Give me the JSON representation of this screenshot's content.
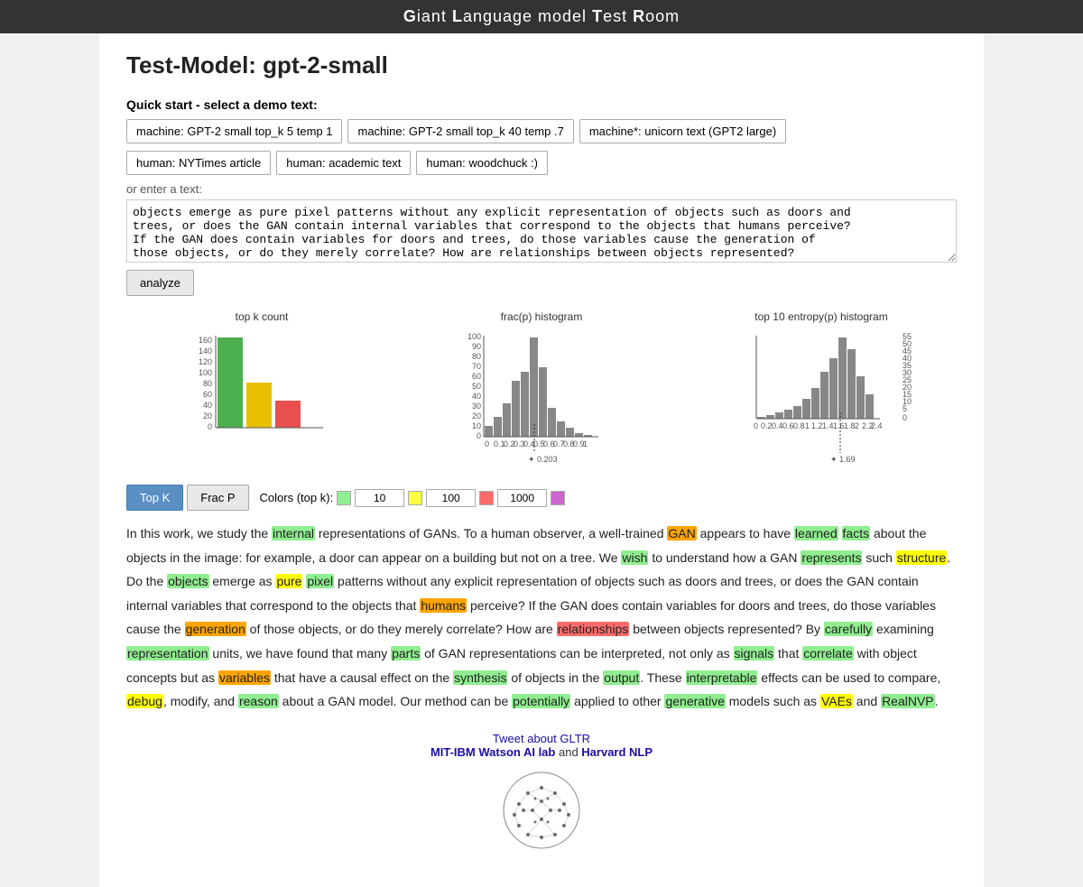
{
  "topbar": {
    "title": "Giant Language model Test Room",
    "title_parts": [
      "G",
      "iant ",
      "L",
      "anguage model ",
      "T",
      "est ",
      "R",
      "oom"
    ]
  },
  "page": {
    "title": "Test-Model: gpt-2-small"
  },
  "quick_start": {
    "label": "Quick start - select a demo text:",
    "buttons": [
      "machine: GPT-2 small top_k 5 temp 1",
      "machine: GPT-2 small top_k 40 temp .7",
      "machine*: unicorn text (GPT2 large)",
      "human: NYTimes article",
      "human: academic text",
      "human: woodchuck :)"
    ]
  },
  "enter_text": {
    "label": "or enter a text:",
    "placeholder": "objects emerge as pure pixel patterns without any explicit representation of objects such as doors and trees, or does the GAN contain internal variables that correspond to the objects that humans perceive?\nIf the GAN does contain variables for doors and trees, do those variables cause the generation of\nthose objects, or do they merely correlate? How are relationships between objects represented?",
    "value": "objects emerge as pure pixel patterns without any explicit representation of objects such as doors and\ntrees, or does the GAN contain internal variables that correspond to the objects that humans perceive?\nIf the GAN does contain variables for doors and trees, do those variables cause the generation of\nthose objects, or do they merely correlate? How are relationships between objects represented?"
  },
  "analyze_btn": "analyze",
  "charts": {
    "topk": {
      "title": "top k count"
    },
    "fracp": {
      "title": "frac(p) histogram",
      "marker": "0.203"
    },
    "entropy": {
      "title": "top 10 entropy(p) histogram",
      "marker": "1.69"
    }
  },
  "tabs": {
    "top_k": "Top K",
    "frac_p": "Frac P",
    "colors_label": "Colors (top k):",
    "inputs": [
      "10",
      "100",
      "1000"
    ],
    "swatches": [
      "#90ee90",
      "#ffff44",
      "#ff6b6b",
      "#cc66cc"
    ]
  },
  "result_paragraph": "In this work, we study the internal representations of GANs. To a human observer, a well-trained GAN appears to have learned facts about the objects in the image: for example, a door can appear on a building but not on a tree. We wish to understand how a GAN represents such structure. Do the objects emerge as pure pixel patterns without any explicit representation of objects such as doors and trees, or does the GAN contain internal variables that correspond to the objects that humans perceive? If the GAN does contain variables for doors and trees, do those variables cause the generation of those objects, or do they merely correlate? How are relationships between objects represented? By carefully examining representation units, we have found that many parts of GAN representations can be interpreted, not only as signals that correlate with object concepts but as variables that have a causal effect on the synthesis of objects in the output. These interpretable effects can be used to compare, debug, modify, and reason about a GAN model. Our method can be potentially applied to other generative models such as VAEs and RealNVP.",
  "footer": {
    "tweet": "Tweet about GLTR",
    "lab1": "MIT-IBM Watson AI lab",
    "and": "and",
    "lab2": "Harvard NLP"
  }
}
